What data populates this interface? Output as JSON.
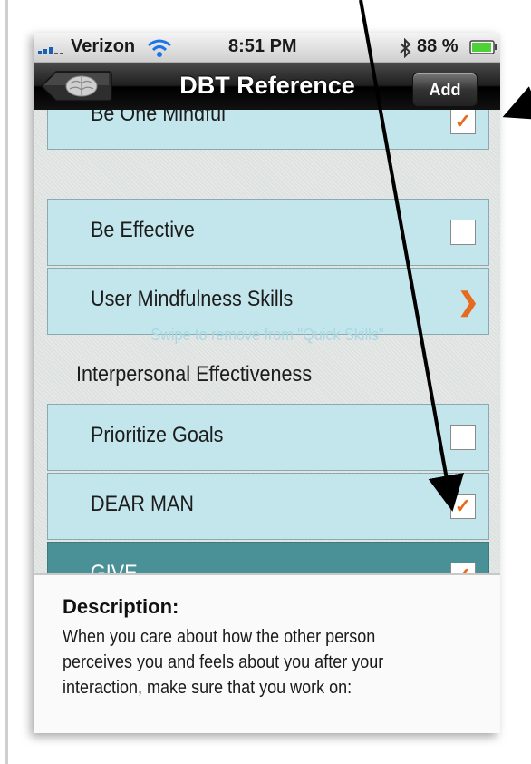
{
  "status_bar": {
    "carrier": "Verizon",
    "time": "8:51 PM",
    "battery": "88 %"
  },
  "nav": {
    "title": "DBT Reference",
    "add_label": "Add"
  },
  "rows_top": [
    {
      "label": "Be One Mindful",
      "checked": true
    },
    {
      "label": "Be Effective",
      "checked": false
    },
    {
      "label": "User Mindfulness Skills",
      "disclosure": true
    }
  ],
  "hint": "Swipe to remove from \"Quick Skills\"",
  "section_title": "Interpersonal Effectiveness",
  "rows_bottom": [
    {
      "label": "Prioritize Goals",
      "checked": false
    },
    {
      "label": "DEAR MAN",
      "checked": true
    },
    {
      "label": "GIVE",
      "checked": true
    }
  ],
  "description": {
    "title": "Description:",
    "text": "When you care about how the other person perceives you and feels about you after your interaction, make sure that you work on:"
  },
  "check_glyph": "✓",
  "chevron_glyph": "❯",
  "colors": {
    "row_bg": "#c3e6ec",
    "row_selected_bg": "#4a9097",
    "accent_orange": "#e76a1e",
    "hint_text": "#a8d8e3"
  }
}
